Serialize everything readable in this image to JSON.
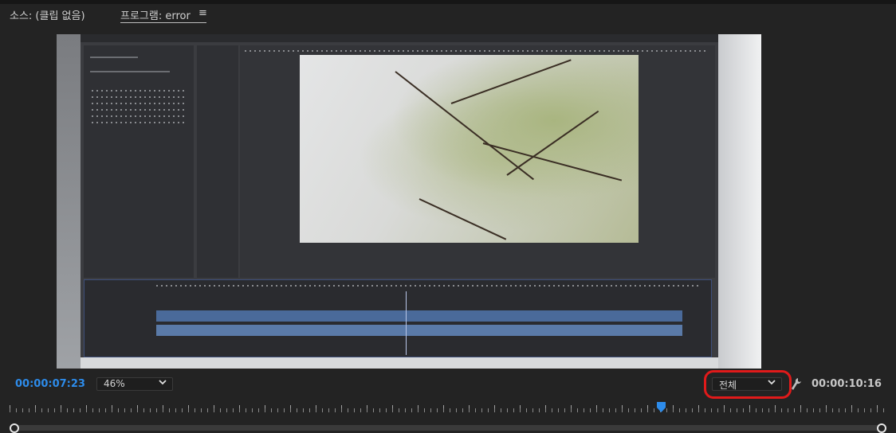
{
  "tabs": {
    "source_label": "소스: (클립 없음)",
    "program_label": "프로그램: error",
    "menu_icon": "hamburger-menu-icon"
  },
  "playback": {
    "current_timecode": "00:00:07:23",
    "duration_timecode": "00:00:10:16",
    "playhead_position_fraction": 0.743
  },
  "zoom": {
    "selected": "46%"
  },
  "resolution": {
    "selected": "전체",
    "highlight_color": "#e01a1a"
  },
  "colors": {
    "timecode_accent": "#2d8ceb",
    "panel_bg": "#232323"
  },
  "icons": {
    "settings": "wrench-icon",
    "playhead": "playhead-marker-icon",
    "dropdown": "chevron-down-icon"
  }
}
